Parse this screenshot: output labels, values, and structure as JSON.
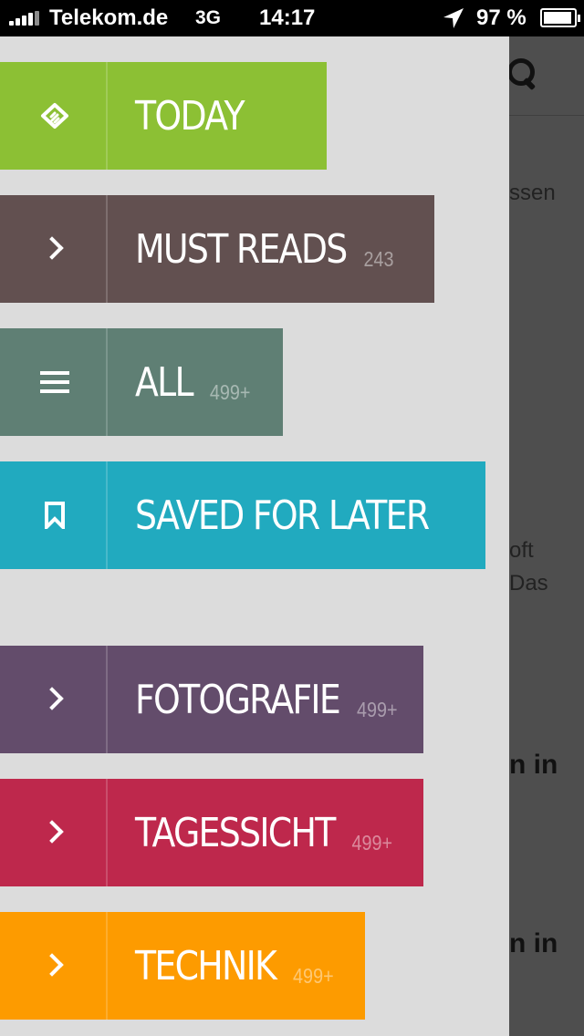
{
  "status_bar": {
    "carrier": "Telekom.de",
    "network": "3G",
    "time": "14:17",
    "battery": "97 %"
  },
  "background_feed": {
    "snippets": [
      "ssen",
      "oft",
      "Das",
      "n in",
      "n in"
    ]
  },
  "drawer": {
    "items": [
      {
        "label": "TODAY",
        "count": "",
        "icon": "feedly-logo-icon",
        "color": "#8cc034"
      },
      {
        "label": "MUST READS",
        "count": "243",
        "icon": "chevron-right-icon",
        "color": "#625050"
      },
      {
        "label": "ALL",
        "count": "499+",
        "icon": "list-icon",
        "color": "#5f7f74"
      },
      {
        "label": "SAVED FOR LATER",
        "count": "",
        "icon": "bookmark-icon",
        "color": "#21aabf"
      },
      {
        "label": "FOTOGRAFIE",
        "count": "499+",
        "icon": "chevron-right-icon",
        "color": "#634c6b"
      },
      {
        "label": "TAGESSICHT",
        "count": "499+",
        "icon": "chevron-right-icon",
        "color": "#be284c"
      },
      {
        "label": "TECHNIK",
        "count": "499+",
        "icon": "chevron-right-icon",
        "color": "#fd9b00"
      }
    ]
  }
}
